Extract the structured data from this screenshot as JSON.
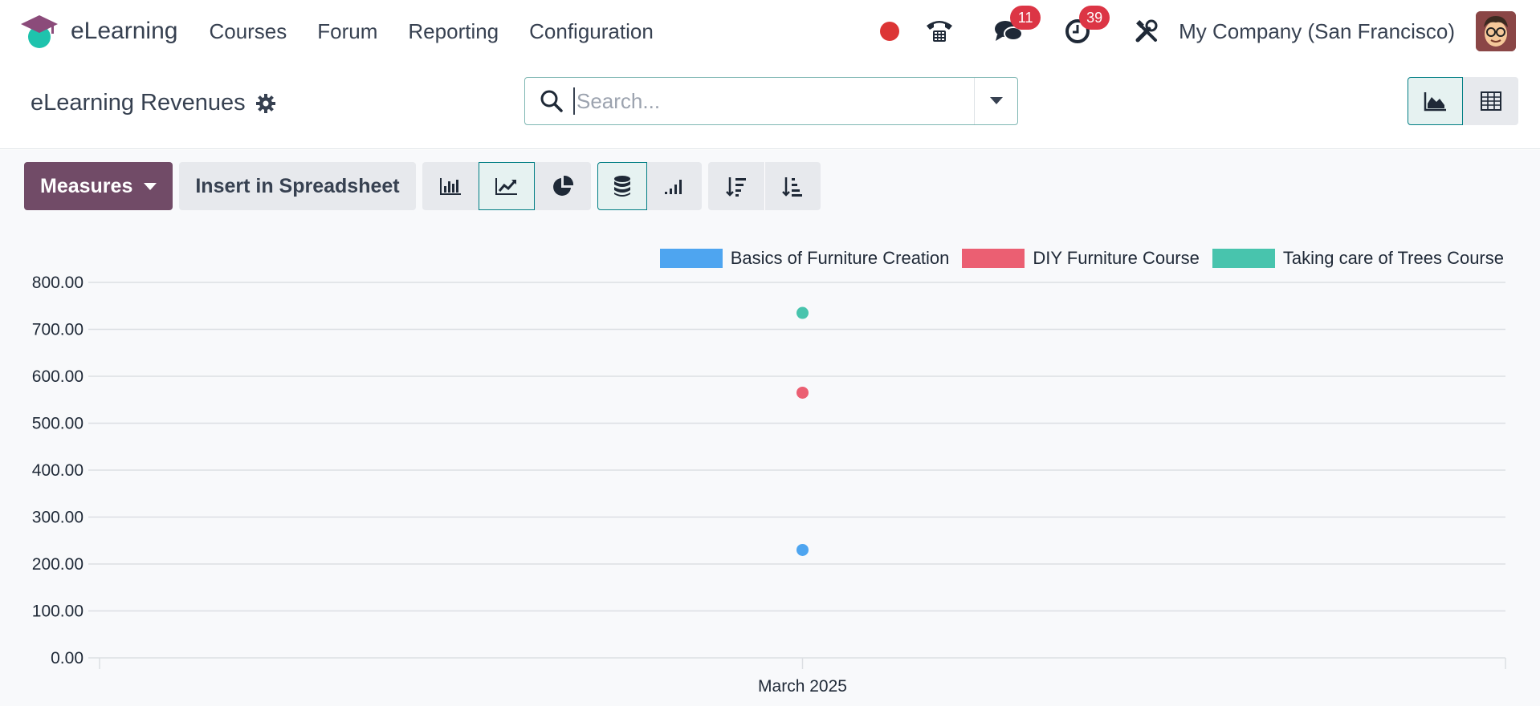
{
  "navbar": {
    "app_name": "eLearning",
    "menu": [
      "Courses",
      "Forum",
      "Reporting",
      "Configuration"
    ],
    "messages_count": "11",
    "activities_count": "39",
    "company": "My Company (San Francisco)"
  },
  "control": {
    "title": "eLearning Revenues",
    "search_placeholder": "Search..."
  },
  "toolbar": {
    "measures_label": "Measures",
    "insert_label": "Insert in Spreadsheet"
  },
  "colors": {
    "brand": "#714b67",
    "accent": "#017e84",
    "series": [
      "#4ea5f0",
      "#eb5f72",
      "#48c4ad"
    ]
  },
  "chart_data": {
    "type": "scatter",
    "categories": [
      "March 2025"
    ],
    "series": [
      {
        "name": "Basics of Furniture Creation",
        "values": [
          230
        ]
      },
      {
        "name": "DIY Furniture Course",
        "values": [
          565
        ]
      },
      {
        "name": "Taking care of Trees Course",
        "values": [
          735
        ]
      }
    ],
    "yticks": [
      "0.00",
      "100.00",
      "200.00",
      "300.00",
      "400.00",
      "500.00",
      "600.00",
      "700.00",
      "800.00"
    ],
    "ylim": [
      0,
      800
    ],
    "grid": true,
    "legend_position": "top-right"
  }
}
